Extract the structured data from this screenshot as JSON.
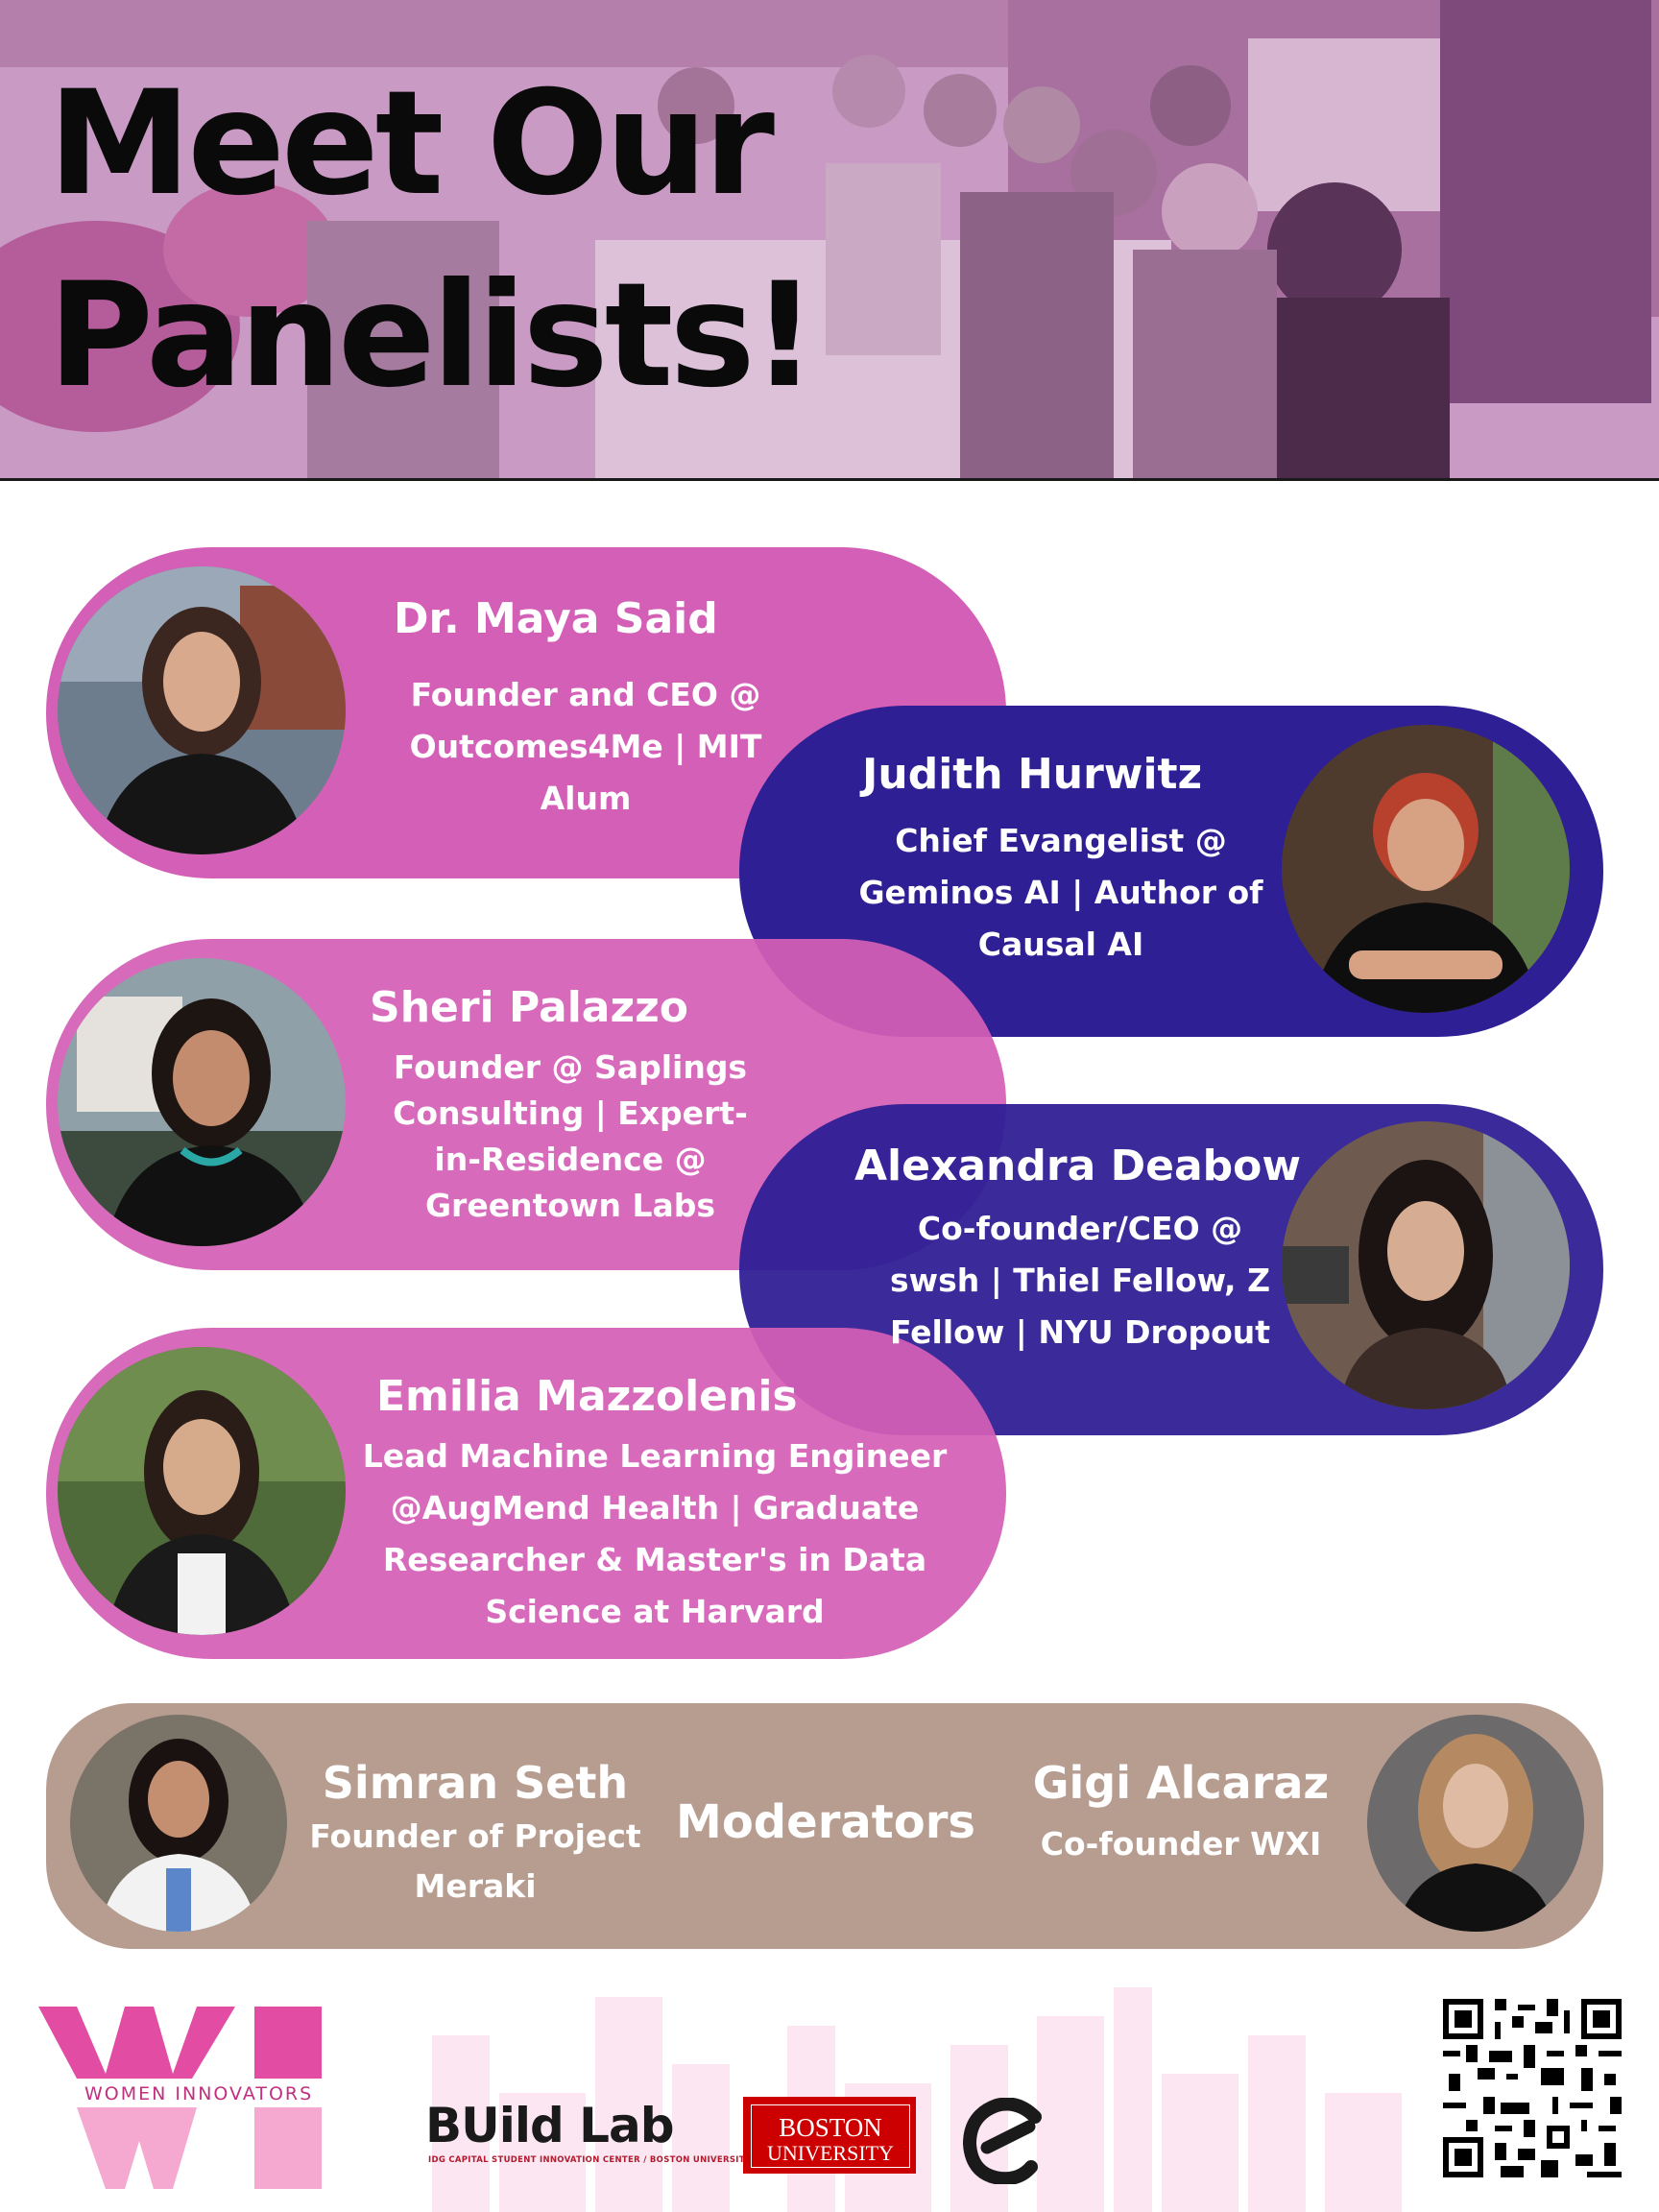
{
  "hero": {
    "title_line1": "Meet Our",
    "title_line2": "Panelists!"
  },
  "panelists": [
    {
      "name": "Dr. Maya Said",
      "desc": "Founder and CEO @ Outcomes4Me | MIT Alum"
    },
    {
      "name": "Judith Hurwitz",
      "desc": "Chief Evangelist @ Geminos AI | Author of Causal AI"
    },
    {
      "name": "Sheri Palazzo",
      "desc": "Founder @ Saplings Consulting | Expert-in-Residence @ Greentown Labs"
    },
    {
      "name": "Alexandra Deabow",
      "desc": "Co-founder/CEO @ swsh | Thiel Fellow, Z Fellow | NYU Dropout"
    },
    {
      "name": "Emilia Mazzolenis",
      "desc": "Lead Machine Learning Engineer @AugMend Health | Graduate Researcher & Master's in Data Science at Harvard"
    }
  ],
  "moderators": {
    "label": "Moderators",
    "left": {
      "name": "Simran Seth",
      "desc": "Founder of Project Meraki"
    },
    "right": {
      "name": "Gigi Alcaraz",
      "desc": "Co-founder WXI"
    }
  },
  "footer": {
    "wi_text": "WOMEN INNOVATORS",
    "buildlab_name": "BUild Lab",
    "buildlab_sub": "IDG CAPITAL STUDENT INNOVATION CENTER / BOSTON UNIVERSITY",
    "bu_line1": "BOSTON",
    "bu_line2": "UNIVERSITY"
  },
  "colors": {
    "pink": "#d45fb6",
    "navy": "#2f1f95",
    "moderator_bg": "#b79c90",
    "hero_tint": "#c48fbe"
  }
}
